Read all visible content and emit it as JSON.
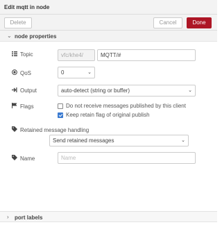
{
  "window": {
    "title": "Edit mqtt in node"
  },
  "toolbar": {
    "delete_label": "Delete",
    "cancel_label": "Cancel",
    "done_label": "Done"
  },
  "sections": {
    "node_properties": "node properties",
    "port_labels": "port labels"
  },
  "fields": {
    "topic": {
      "label": "Topic",
      "prefix": "vfc/khe4/",
      "value": "MQTT/#"
    },
    "qos": {
      "label": "QoS",
      "value": "0"
    },
    "output": {
      "label": "Output",
      "value": "auto-detect (string or buffer)"
    },
    "flags": {
      "label": "Flags",
      "no_local": {
        "label": "Do not receive messages published by this client",
        "checked": false
      },
      "retain_as_published": {
        "label": "Keep retain flag of original publish",
        "checked": true
      }
    },
    "retain_handling": {
      "label": "Retained message handling",
      "value": "Send retained messages"
    },
    "name": {
      "label": "Name",
      "placeholder": "Name"
    }
  },
  "icons": {
    "section_open": "chevron-down-icon",
    "section_closed": "chevron-right-icon",
    "topic": "tasks-icon",
    "qos": "dot-circle-icon",
    "output": "sign-out-icon",
    "flags": "flag-icon",
    "retain": "tag-icon",
    "name": "tag-icon"
  },
  "colors": {
    "done_button": "#ad1625",
    "checkbox_checked": "#3b7bd1"
  }
}
